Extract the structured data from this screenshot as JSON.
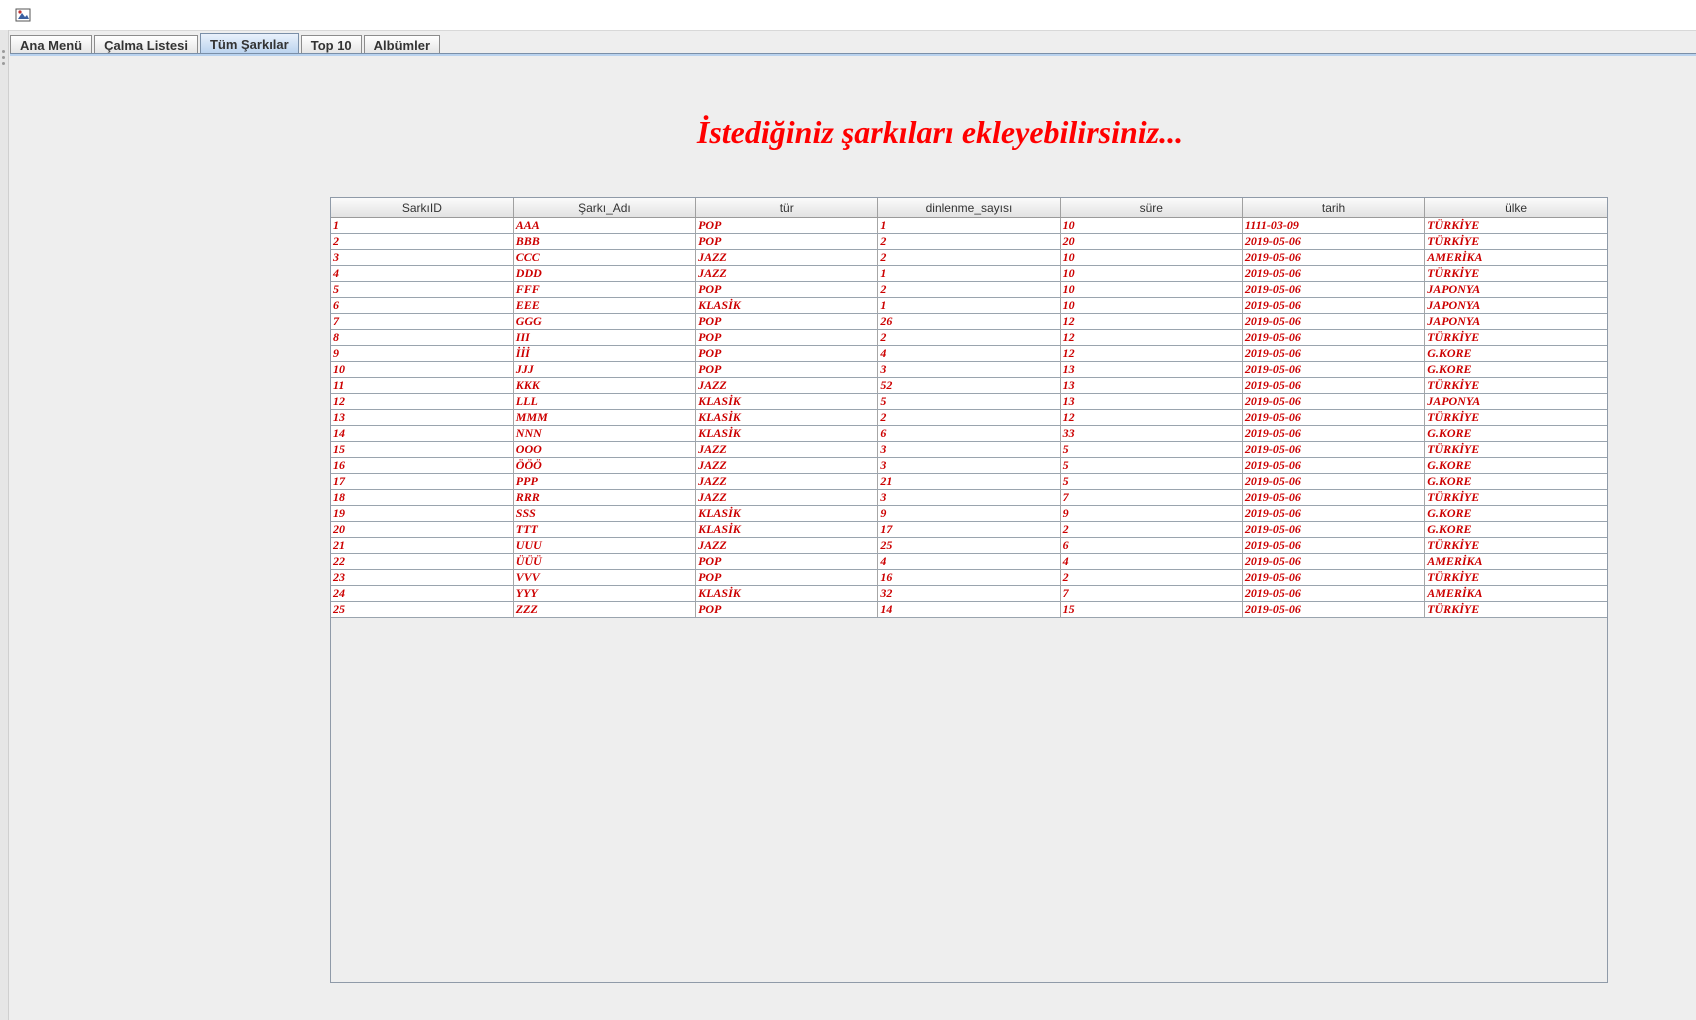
{
  "window": {
    "icon": "java-app-icon"
  },
  "tabs": [
    {
      "label": "Ana Menü",
      "active": false
    },
    {
      "label": "Çalma Listesi",
      "active": false
    },
    {
      "label": "Tüm Şarkılar",
      "active": true
    },
    {
      "label": "Top 10",
      "active": false
    },
    {
      "label": "Albümler",
      "active": false
    }
  ],
  "heading": "İstediğiniz şarkıları ekleyebilirsiniz...",
  "colors": {
    "accent_text": "#ff0000",
    "cell_text": "#cc0000",
    "active_tab": "#b9d2ee"
  },
  "table": {
    "columns": [
      "SarkıID",
      "Şarkı_Adı",
      "tür",
      "dinlenme_sayısı",
      "süre",
      "tarih",
      "ülke"
    ],
    "rows": [
      [
        "1",
        "AAA",
        "POP",
        "1",
        "10",
        "1111-03-09",
        "TÜRKİYE"
      ],
      [
        "2",
        "BBB",
        "POP",
        "2",
        "20",
        "2019-05-06",
        "TÜRKİYE"
      ],
      [
        "3",
        "CCC",
        "JAZZ",
        "2",
        "10",
        "2019-05-06",
        "AMERİKA"
      ],
      [
        "4",
        "DDD",
        "JAZZ",
        "1",
        "10",
        "2019-05-06",
        "TÜRKİYE"
      ],
      [
        "5",
        "FFF",
        "POP",
        "2",
        "10",
        "2019-05-06",
        "JAPONYA"
      ],
      [
        "6",
        "EEE",
        "KLASİK",
        "1",
        "10",
        "2019-05-06",
        "JAPONYA"
      ],
      [
        "7",
        "GGG",
        "POP",
        "26",
        "12",
        "2019-05-06",
        "JAPONYA"
      ],
      [
        "8",
        "III",
        "POP",
        "2",
        "12",
        "2019-05-06",
        "TÜRKİYE"
      ],
      [
        "9",
        "İİİ",
        "POP",
        "4",
        "12",
        "2019-05-06",
        "G.KORE"
      ],
      [
        "10",
        "JJJ",
        "POP",
        "3",
        "13",
        "2019-05-06",
        "G.KORE"
      ],
      [
        "11",
        "KKK",
        "JAZZ",
        "52",
        "13",
        "2019-05-06",
        "TÜRKİYE"
      ],
      [
        "12",
        "LLL",
        "KLASİK",
        "5",
        "13",
        "2019-05-06",
        "JAPONYA"
      ],
      [
        "13",
        "MMM",
        "KLASİK",
        "2",
        "12",
        "2019-05-06",
        "TÜRKİYE"
      ],
      [
        "14",
        "NNN",
        "KLASİK",
        "6",
        "33",
        "2019-05-06",
        "G.KORE"
      ],
      [
        "15",
        "OOO",
        "JAZZ",
        "3",
        "5",
        "2019-05-06",
        "TÜRKİYE"
      ],
      [
        "16",
        "ÖÖÖ",
        "JAZZ",
        "3",
        "5",
        "2019-05-06",
        "G.KORE"
      ],
      [
        "17",
        "PPP",
        "JAZZ",
        "21",
        "5",
        "2019-05-06",
        "G.KORE"
      ],
      [
        "18",
        "RRR",
        "JAZZ",
        "3",
        "7",
        "2019-05-06",
        "TÜRKİYE"
      ],
      [
        "19",
        "SSS",
        "KLASİK",
        "9",
        "9",
        "2019-05-06",
        "G.KORE"
      ],
      [
        "20",
        "TTT",
        "KLASİK",
        "17",
        "2",
        "2019-05-06",
        "G.KORE"
      ],
      [
        "21",
        "UUU",
        "JAZZ",
        "25",
        "6",
        "2019-05-06",
        "TÜRKİYE"
      ],
      [
        "22",
        "ÜÜÜ",
        "POP",
        "4",
        "4",
        "2019-05-06",
        "AMERİKA"
      ],
      [
        "23",
        "VVV",
        "POP",
        "16",
        "2",
        "2019-05-06",
        "TÜRKİYE"
      ],
      [
        "24",
        "YYY",
        "KLASİK",
        "32",
        "7",
        "2019-05-06",
        "AMERİKA"
      ],
      [
        "25",
        "ZZZ",
        "POP",
        "14",
        "15",
        "2019-05-06",
        "TÜRKİYE"
      ]
    ]
  }
}
